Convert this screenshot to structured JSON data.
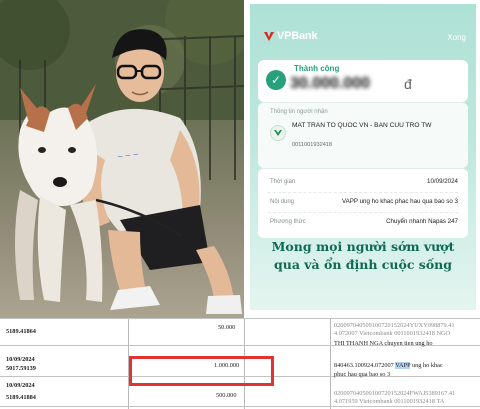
{
  "phone": {
    "brand_name": "VPBank",
    "close_label": "Xong",
    "status_title": "Thành công",
    "amount_blurred": "30.000.000",
    "currency_symbol": "đ",
    "recipient_section_title": "Thông tin người nhận",
    "recipient_name": "MAT TRAN TO QUOC VN - BAN CUU TRO TW",
    "recipient_account": "0011001932418",
    "details": [
      {
        "key": "Thời gian",
        "value": "10/09/2024"
      },
      {
        "key": "Nội dung",
        "value": "VAPP ung ho khac phac hau qua bao so 3"
      },
      {
        "key": "Phương thức",
        "value": "Chuyển nhanh Napas 247"
      }
    ],
    "slogan_line1": "Mong mọi người sớm vượt",
    "slogan_line2": "qua và ổn định cuộc sống",
    "colors": {
      "accent_green": "#26a17b",
      "slogan": "#0f6a55",
      "background": "#bfe7dd"
    }
  },
  "statement": {
    "ref_top": "5189.41864",
    "amount_top": "50.000",
    "date": "10/09/2024",
    "doc_no": "5017.59139",
    "amount_highlighted": "1.000.000",
    "amount_next": "500.000",
    "date_partial": "10/09/2024",
    "ref_bottom": "5189.41884",
    "desc_top_line1": "020097040509100720152024YUXY098879.41",
    "desc_top_line2": "4.072007 Vietcombank 0011001932418 NGO",
    "desc_top_line3": "THI THANH NGA chuyen tien ung ho",
    "desc_main_pre": "840463.100924.072007",
    "desc_main_highlight": "VAPP",
    "desc_main_post": "ung ho khac",
    "desc_main_line2": "phuc hau qua bao so 3",
    "desc_bottom_line1": "020097040509100720152024FWAJ5389167.41",
    "desc_bottom_line2": "4.071959 Vietcombank 0011001932418 TA",
    "highlight_box_color": "#e23333"
  }
}
